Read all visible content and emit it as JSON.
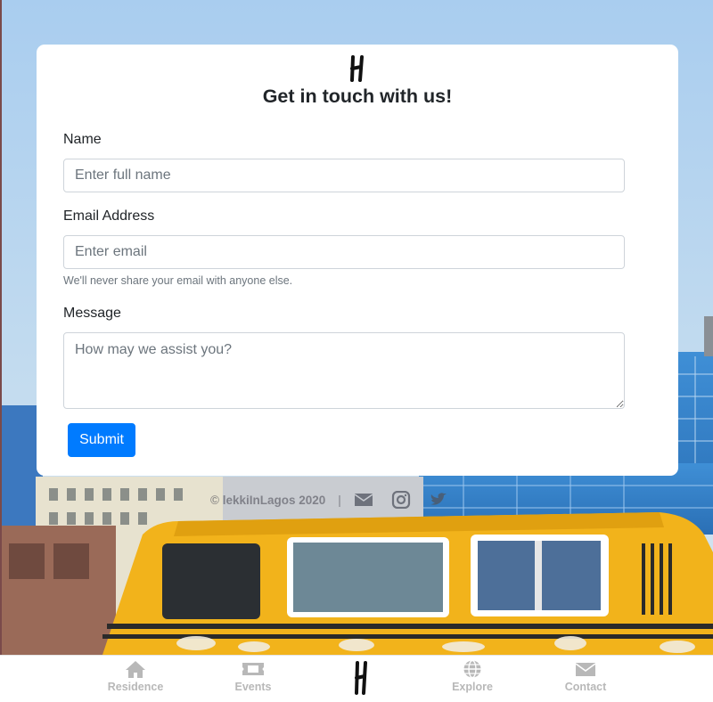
{
  "form": {
    "title": "Get in touch with us!",
    "name": {
      "label": "Name",
      "placeholder": "Enter full name"
    },
    "email": {
      "label": "Email Address",
      "placeholder": "Enter email",
      "help": "We'll never share your email with anyone else."
    },
    "message": {
      "label": "Message",
      "placeholder": "How may we assist you?"
    },
    "submit_label": "Submit"
  },
  "footer": {
    "copyright": "© lekkiInLagos 2020",
    "separator": "|",
    "icons": [
      "envelope-icon",
      "instagram-icon",
      "twitter-icon"
    ]
  },
  "bottom_nav": {
    "items": [
      {
        "label": "Residence",
        "icon": "home-icon"
      },
      {
        "label": "Events",
        "icon": "ticket-icon"
      },
      {
        "label": "Explore",
        "icon": "globe-icon"
      },
      {
        "label": "Contact",
        "icon": "envelope-icon"
      }
    ],
    "logo_icon": "brand-logo-icon"
  },
  "colors": {
    "primary": "#007bff",
    "nav_inactive": "#b8b8b8",
    "bus_yellow": "#f2b31b"
  }
}
